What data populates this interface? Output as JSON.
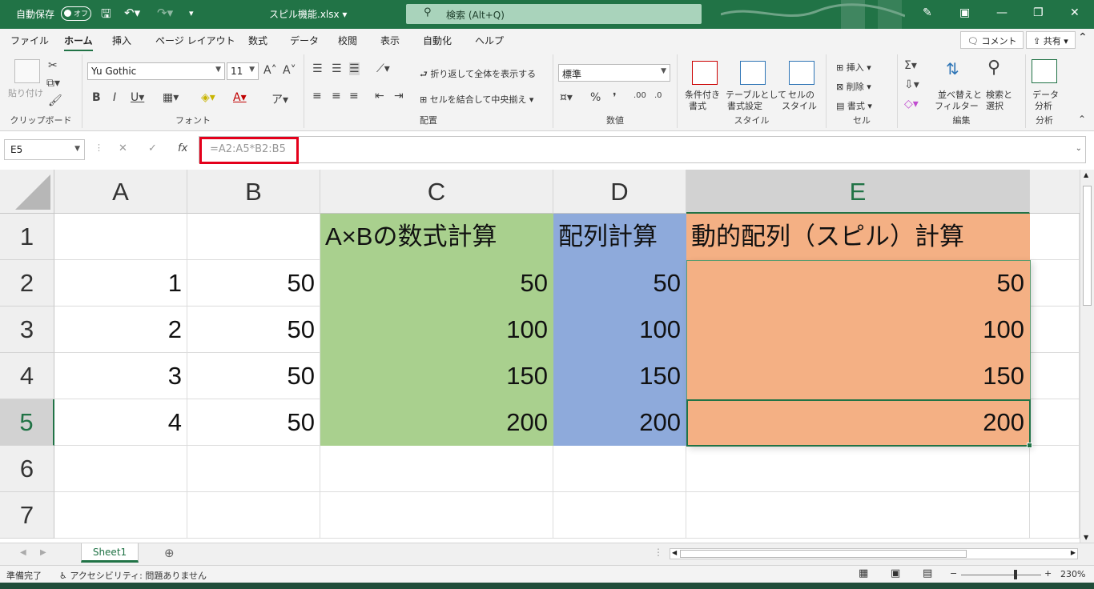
{
  "titlebar": {
    "autosave_label": "自動保存",
    "autosave_state": "オフ",
    "filename": "スピル機能.xlsx",
    "search_placeholder": "検索 (Alt+Q)"
  },
  "tabs": [
    "ファイル",
    "ホーム",
    "挿入",
    "ページ レイアウト",
    "数式",
    "データ",
    "校閲",
    "表示",
    "自動化",
    "ヘルプ"
  ],
  "active_tab": "ホーム",
  "comment_button": "コメント",
  "share_button": "共有",
  "ribbon": {
    "clipboard": {
      "paste": "貼り付け",
      "label": "クリップボード"
    },
    "font": {
      "name": "Yu Gothic",
      "size": "11",
      "label": "フォント"
    },
    "alignment": {
      "wrap": "折り返して全体を表示する",
      "merge": "セルを結合して中央揃え",
      "label": "配置"
    },
    "number": {
      "format": "標準",
      "label": "数値"
    },
    "styles": {
      "conditional_1": "条件付き",
      "conditional_2": "書式",
      "table_1": "テーブルとして",
      "table_2": "書式設定",
      "cell_1": "セルの",
      "cell_2": "スタイル",
      "label": "スタイル"
    },
    "cells": {
      "insert": "挿入",
      "delete": "削除",
      "format": "書式",
      "label": "セル"
    },
    "editing": {
      "sort_1": "並べ替えと",
      "sort_2": "フィルター",
      "find_1": "検索と",
      "find_2": "選択",
      "label": "編集"
    },
    "analysis": {
      "data_1": "データ",
      "data_2": "分析",
      "label": "分析"
    }
  },
  "formula_bar": {
    "name_box": "E5",
    "formula": "=A2:A5*B2:B5"
  },
  "sheet": {
    "columns": [
      "A",
      "B",
      "C",
      "D",
      "E"
    ],
    "rows": [
      "1",
      "2",
      "3",
      "4",
      "5",
      "6",
      "7"
    ],
    "selected_column": "E",
    "selected_row": "5",
    "headers": {
      "C1": "A×Bの数式計算",
      "D1": "配列計算",
      "E1": "動的配列（スピル）計算"
    },
    "A": [
      "1",
      "2",
      "3",
      "4"
    ],
    "B": [
      "50",
      "50",
      "50",
      "50"
    ],
    "C": [
      "50",
      "100",
      "150",
      "200"
    ],
    "D": [
      "50",
      "100",
      "150",
      "200"
    ],
    "E": [
      "50",
      "100",
      "150",
      "200"
    ],
    "colors": {
      "C": "#a9d08e",
      "D": "#8eaadb",
      "E": "#f4b084",
      "accent": "#217346",
      "highlight_box": "#e4001b"
    }
  },
  "sheet_tab": "Sheet1",
  "status": {
    "ready": "準備完了",
    "accessibility": "アクセシビリティ: 問題ありません",
    "zoom": "230%"
  }
}
